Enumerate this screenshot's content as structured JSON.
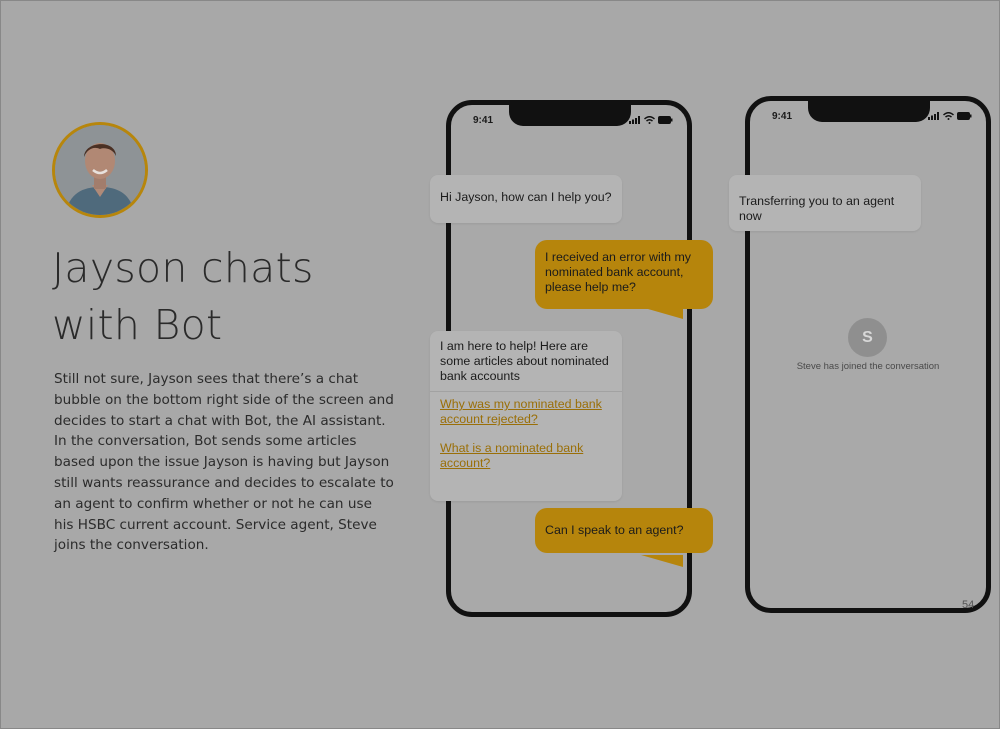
{
  "slide": {
    "headline": "Jayson chats with Bot",
    "description": "Still not sure, Jayson sees that there’s a chat bubble on the bottom right side of the screen and decides to start a chat with Bot, the AI assistant. In the conversation, Bot sends some articles based upon the issue Jayson is having but Jayson still wants reassurance and decides to escalate to an agent to confirm whether or not he can use his HSBC current account. Service agent, Steve joins the conversation.",
    "page_number": "54"
  },
  "phone1": {
    "time": "9:41",
    "messages": {
      "bot_greeting": "Hi Jayson, how can I help you?",
      "user_error": "I received an error with my nominated bank account, please help me?",
      "bot_help": "I am here to help! Here are some articles about nominated bank accounts",
      "article_1": "Why was my nominated bank account rejected?",
      "article_2": "What is a nominated bank account?",
      "user_agent_request": "Can I speak to an agent?"
    }
  },
  "phone2": {
    "time": "9:41",
    "transfer_message": "Transferring you to an agent now",
    "agent_initial": "S",
    "joined_text": "Steve has joined the conversation"
  },
  "colors": {
    "background": "#a8a8a8",
    "accent": "#b6850c",
    "bot_bubble": "#b4b4b4",
    "link": "#9a6f08"
  },
  "icons": [
    "signal-icon",
    "wifi-icon",
    "battery-icon"
  ]
}
